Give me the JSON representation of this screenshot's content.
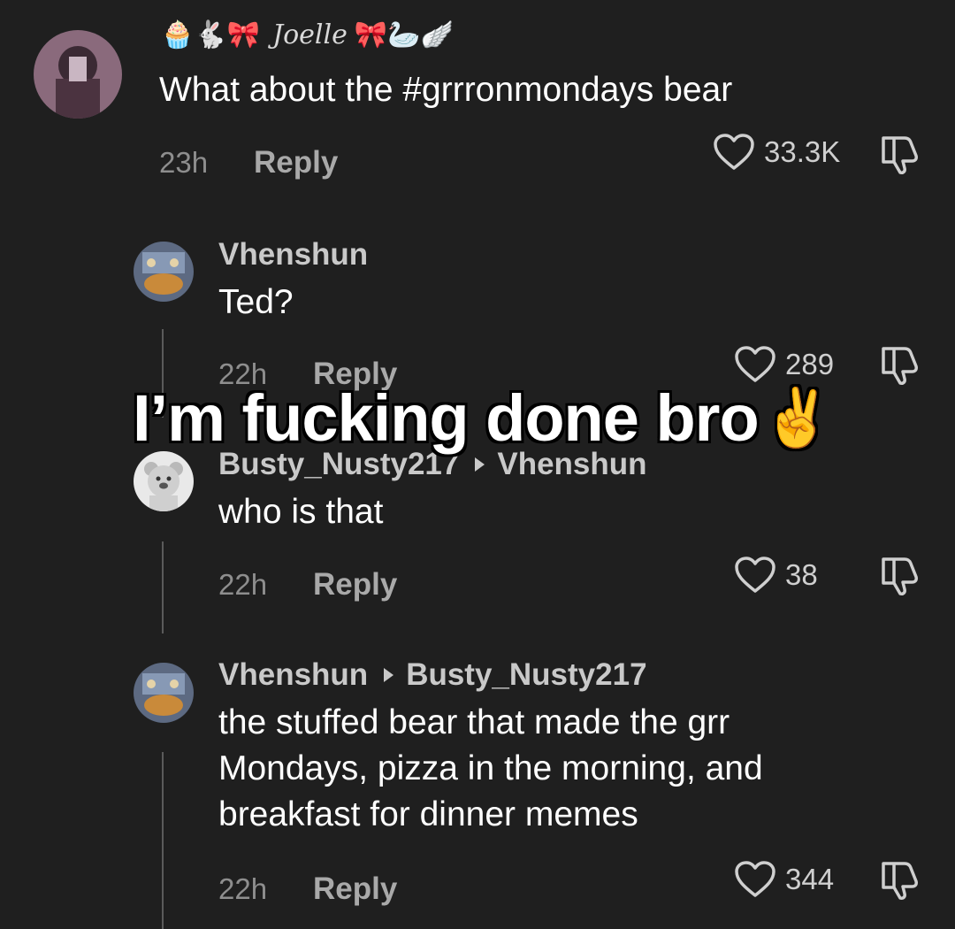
{
  "comments": [
    {
      "username_prefix": "🧁🐇🎀",
      "username": "Joelle",
      "username_suffix": "🎀🦢🪽",
      "text": "What about the #grrronmondays bear",
      "time": "23h",
      "reply": "Reply",
      "likes": "33.3K"
    },
    {
      "username": "Vhenshun",
      "text": "Ted?",
      "time": "22h",
      "reply": "Reply",
      "likes": "289"
    },
    {
      "username": "Busty_Nusty217",
      "reply_to": "Vhenshun",
      "text": "who is that",
      "time": "22h",
      "reply": "Reply",
      "likes": "38"
    },
    {
      "username": "Vhenshun",
      "reply_to": "Busty_Nusty217",
      "text_lines": [
        "the stuffed bear that made the grr",
        "Mondays, pizza in the morning, and",
        "breakfast for dinner memes"
      ],
      "time": "22h",
      "reply": "Reply",
      "likes": "344"
    }
  ],
  "overlay": {
    "text": "I’m fucking done bro",
    "emoji": "✌️"
  },
  "colors": {
    "background": "#1f1f1f",
    "username": "#c9c9c9",
    "body": "#ffffff",
    "meta": "#8e8e8e"
  }
}
